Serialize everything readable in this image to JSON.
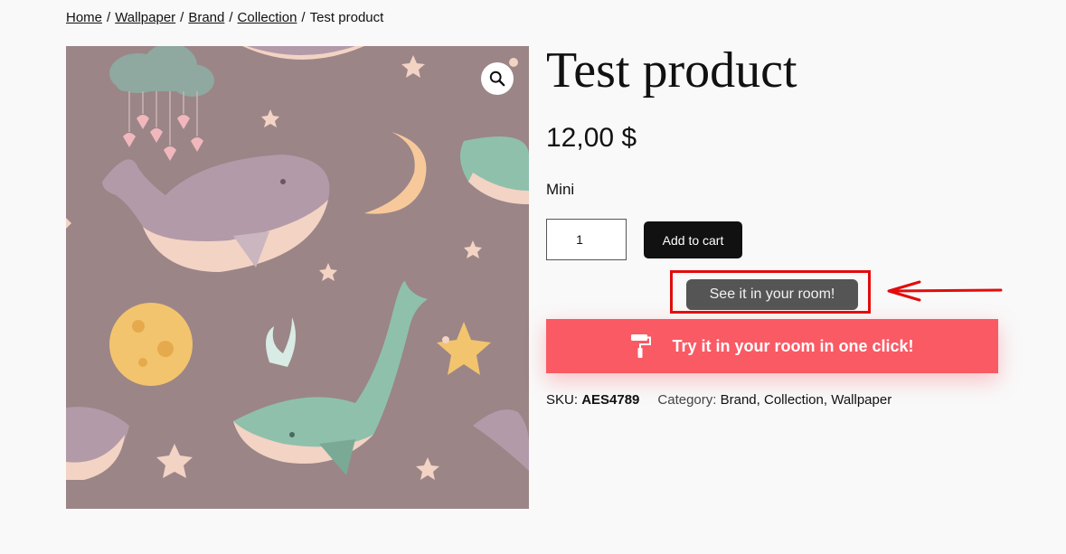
{
  "breadcrumb": {
    "items": [
      "Home",
      "Wallpaper",
      "Brand",
      "Collection"
    ],
    "separator": "/",
    "current": "Test product"
  },
  "product": {
    "title": "Test product",
    "price": "12,00 $",
    "variant": "Mini",
    "quantity": "1",
    "add_to_cart_label": "Add to cart",
    "see_room_label": "See it in your room!",
    "try_room_label": "Try it in your room in one click!",
    "sku_label": "SKU:",
    "sku": "AES4789",
    "category_label": "Category:",
    "categories": [
      "Brand",
      "Collection",
      "Wallpaper"
    ],
    "category_separator": ","
  },
  "icons": {
    "zoom": "magnifier-icon",
    "paint_roller": "paint-roller-icon",
    "annotation_arrow": "arrow-left-icon"
  },
  "colors": {
    "image_bg": "#9b8587",
    "cart_button": "#111111",
    "see_room_button": "#555555",
    "try_room_button": "#f95a64",
    "highlight": "#e30c0c"
  }
}
